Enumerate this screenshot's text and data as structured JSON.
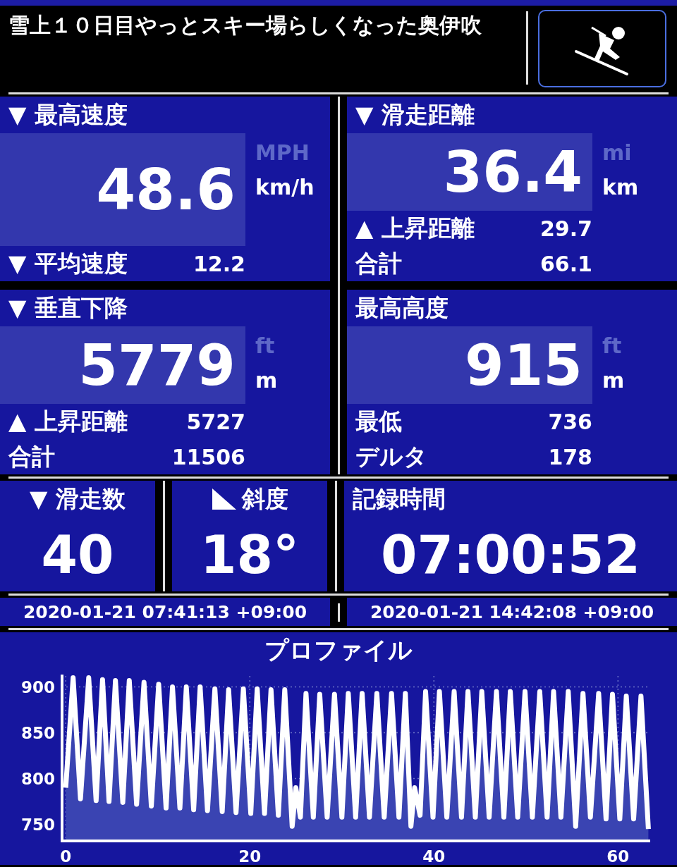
{
  "title": "雪上１０日目やっとスキー場らしくなった奥伊吹",
  "stats": [
    {
      "label": "▼ 最高速度",
      "value": "48.6",
      "units": [
        {
          "label": "MPH",
          "selected": false
        },
        {
          "label": "km/h",
          "selected": true
        }
      ],
      "rows": [
        {
          "label": "▼ 平均速度",
          "value": "12.2"
        }
      ]
    },
    {
      "label": "▼ 滑走距離",
      "value": "36.4",
      "units": [
        {
          "label": "mi",
          "selected": false
        },
        {
          "label": "km",
          "selected": true
        }
      ],
      "rows": [
        {
          "label": "▲ 上昇距離",
          "value": "29.7"
        },
        {
          "label": "合計",
          "value": "66.1"
        }
      ]
    },
    {
      "label": "▼ 垂直下降",
      "value": "5779",
      "units": [
        {
          "label": "ft",
          "selected": false
        },
        {
          "label": "m",
          "selected": true
        }
      ],
      "rows": [
        {
          "label": "▲ 上昇距離",
          "value": "5727"
        },
        {
          "label": "合計",
          "value": "11506"
        }
      ]
    },
    {
      "label": "最高高度",
      "value": "915",
      "units": [
        {
          "label": "ft",
          "selected": false
        },
        {
          "label": "m",
          "selected": true
        }
      ],
      "rows": [
        {
          "label": "最低",
          "value": "736"
        },
        {
          "label": "デルタ",
          "value": "178"
        }
      ]
    }
  ],
  "counters": [
    {
      "kind": "plain",
      "label": "▼ 滑走数",
      "value": "40"
    },
    {
      "kind": "slope",
      "label": "斜度",
      "value": "18°"
    },
    {
      "kind": "plain",
      "label": "記録時間",
      "value": "07:00:52"
    }
  ],
  "times": [
    "2020-01-21 07:41:13 +09:00",
    "2020-01-21 14:42:08 +09:00"
  ],
  "profile": {
    "title": "プロファイル",
    "chart_data": {
      "type": "area",
      "grid": true,
      "xlim": [
        -0.4,
        63.5
      ],
      "ylim": [
        732,
        912
      ],
      "xticks": [
        0,
        20,
        40,
        60
      ],
      "yticks": [
        750,
        800,
        850,
        900
      ],
      "x": [
        0,
        0.8,
        1.6,
        2.5,
        3.3,
        4.0,
        4.7,
        5.4,
        6.2,
        6.9,
        7.7,
        8.5,
        9.3,
        10.1,
        10.9,
        11.6,
        12.4,
        13.1,
        13.9,
        14.6,
        15.4,
        16.2,
        17.0,
        17.7,
        18.5,
        19.3,
        20.1,
        20.8,
        21.6,
        22.3,
        23.1,
        23.8,
        24.6,
        25.0,
        25.5,
        26.1,
        26.9,
        27.6,
        28.4,
        29.2,
        30.0,
        30.7,
        31.5,
        32.2,
        33.0,
        33.8,
        34.6,
        35.4,
        36.2,
        36.9,
        37.5,
        37.9,
        38.5,
        39.1,
        39.9,
        40.6,
        41.4,
        42.2,
        43.0,
        43.7,
        44.5,
        45.2,
        46.0,
        46.8,
        47.6,
        48.3,
        49.1,
        49.9,
        50.7,
        51.5,
        52.3,
        53.0,
        53.8,
        54.6,
        55.4,
        56.2,
        57.0,
        57.9,
        58.7,
        59.4,
        60.2,
        60.9,
        61.7,
        62.5,
        63.3
      ],
      "series": [
        {
          "color": "#ffffff",
          "values": [
            790,
            910,
            778,
            910,
            776,
            908,
            775,
            907,
            774,
            907,
            772,
            905,
            770,
            903,
            768,
            900,
            768,
            900,
            766,
            900,
            765,
            898,
            764,
            897,
            763,
            898,
            762,
            898,
            762,
            897,
            760,
            897,
            748,
            790,
            758,
            893,
            758,
            892,
            758,
            892,
            758,
            893,
            758,
            893,
            758,
            893,
            758,
            893,
            758,
            893,
            748,
            790,
            760,
            895,
            758,
            895,
            758,
            895,
            758,
            895,
            758,
            895,
            758,
            895,
            758,
            895,
            758,
            895,
            758,
            895,
            758,
            895,
            758,
            895,
            748,
            893,
            758,
            893,
            756,
            892,
            756,
            890,
            756,
            890,
            745
          ]
        }
      ]
    }
  }
}
